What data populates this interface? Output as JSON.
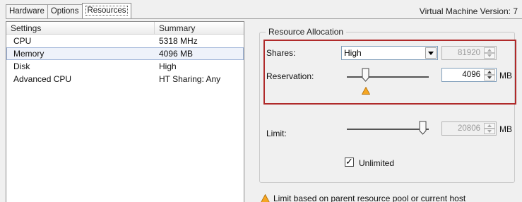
{
  "tabs": [
    {
      "label": "Hardware"
    },
    {
      "label": "Options"
    },
    {
      "label": "Resources"
    }
  ],
  "vm_version": "Virtual Machine Version: 7",
  "list": {
    "headers": {
      "settings": "Settings",
      "summary": "Summary"
    },
    "rows": [
      {
        "setting": "CPU",
        "summary": "5318 MHz"
      },
      {
        "setting": "Memory",
        "summary": "4096 MB"
      },
      {
        "setting": "Disk",
        "summary": "High"
      },
      {
        "setting": "Advanced CPU",
        "summary": "HT Sharing: Any"
      }
    ],
    "selected_index": 1
  },
  "resource_allocation": {
    "title": "Resource Allocation",
    "shares": {
      "label": "Shares:",
      "selected": "High",
      "value": "81920"
    },
    "reservation": {
      "label": "Reservation:",
      "value": "4096",
      "unit": "MB"
    },
    "limit": {
      "label": "Limit:",
      "value": "20806",
      "unit": "MB"
    },
    "unlimited": {
      "label": "Unlimited",
      "checked": true
    }
  },
  "warning": {
    "text": "Limit based on parent resource pool or current host",
    "icon": "warning-triangle-icon"
  },
  "colors": {
    "highlight_border": "#b02a2a",
    "warning_fill": "#f5a623"
  }
}
